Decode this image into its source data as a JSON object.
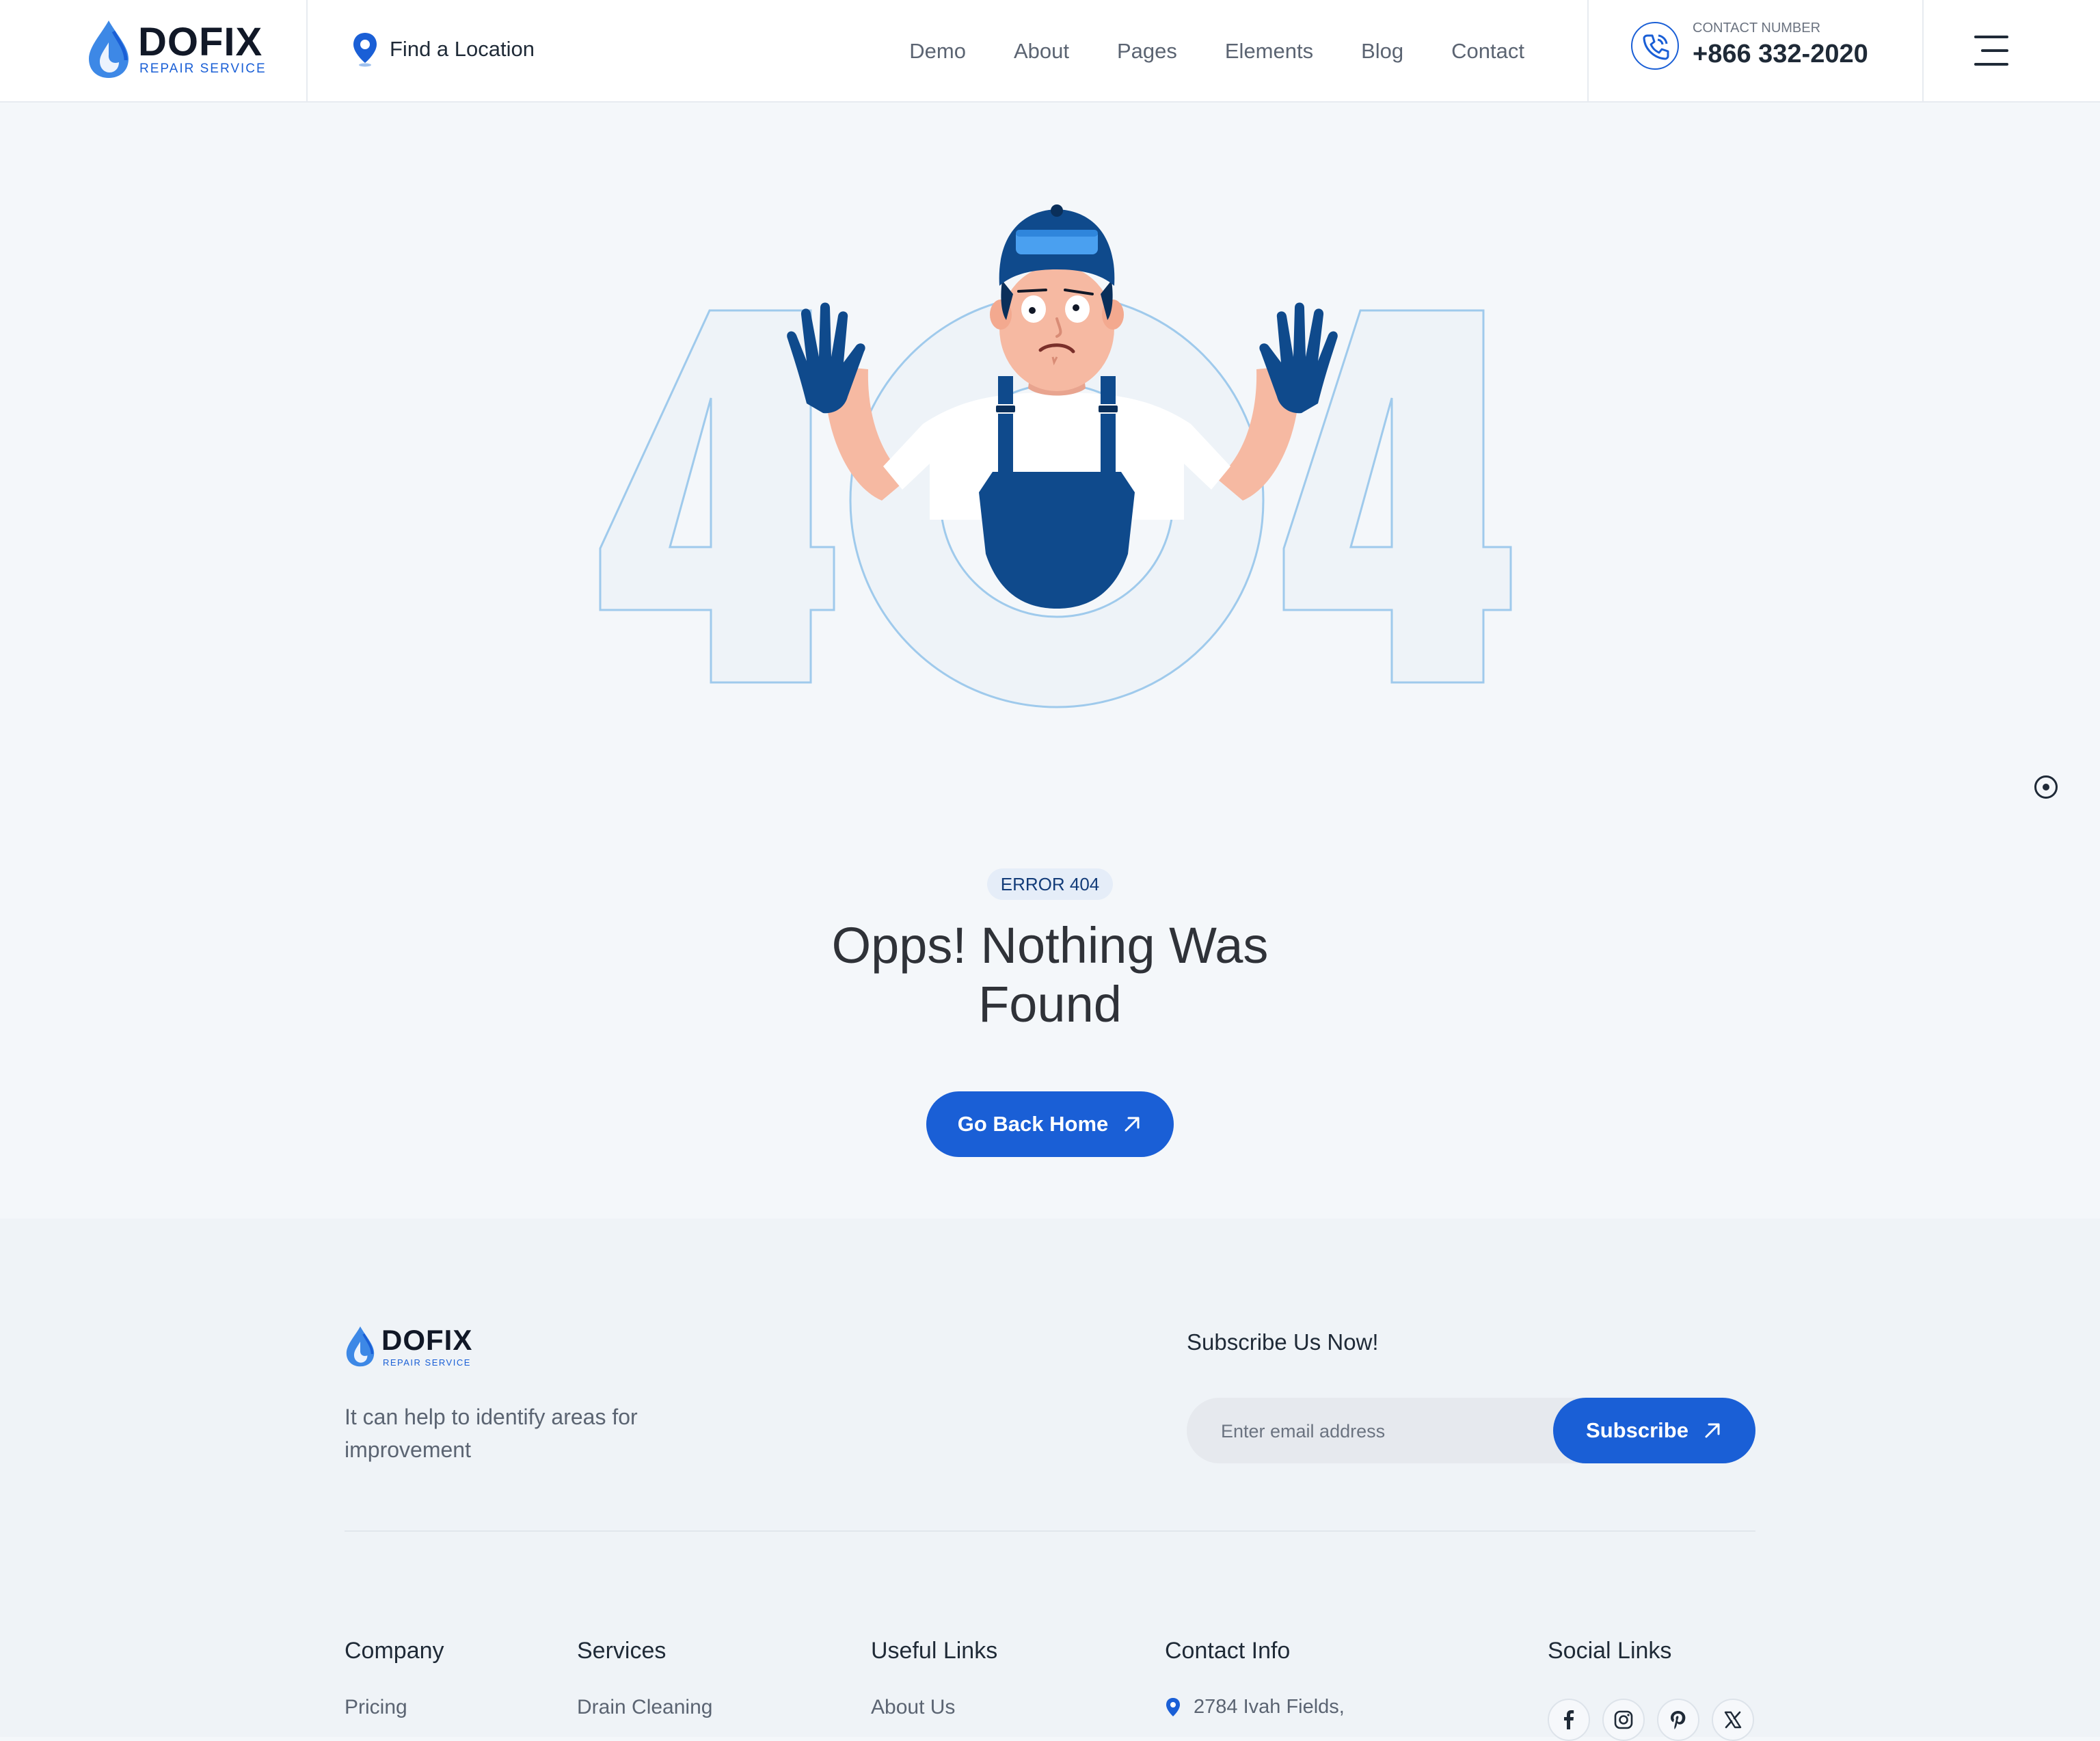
{
  "header": {
    "brand": {
      "name": "DOFIX",
      "tagline": "REPAIR SERVICE"
    },
    "find_location": "Find a Location",
    "nav": [
      "Demo",
      "About",
      "Pages",
      "Elements",
      "Blog",
      "Contact"
    ],
    "contact": {
      "label": "CONTACT NUMBER",
      "number": "+866 332-2020"
    }
  },
  "hero": {
    "error_badge": "ERROR 404",
    "title_line1": "Opps! Nothing Was",
    "title_line2": "Found",
    "button_label": "Go Back Home"
  },
  "footer": {
    "brand": {
      "name": "DOFIX",
      "tagline": "REPAIR SERVICE"
    },
    "tagline": "It can help to identify areas for improvement",
    "subscribe": {
      "title": "Subscribe Us Now!",
      "placeholder": "Enter email address",
      "button_label": "Subscribe"
    },
    "columns": {
      "company": {
        "title": "Company",
        "links": [
          "Pricing"
        ]
      },
      "services": {
        "title": "Services",
        "links": [
          "Drain Cleaning"
        ]
      },
      "useful": {
        "title": "Useful Links",
        "links": [
          "About Us"
        ]
      },
      "contact": {
        "title": "Contact Info",
        "address": "2784 Ivah Fields,"
      },
      "social": {
        "title": "Social Links",
        "icons": [
          "facebook-icon",
          "instagram-icon",
          "pinterest-icon",
          "x-icon"
        ]
      }
    }
  },
  "colors": {
    "accent": "#1a5fd6",
    "navy": "#0f4a8c",
    "hero_bg": "#f4f7fa",
    "footer_bg": "#eff3f7",
    "outline_blue": "#9fcaec"
  }
}
